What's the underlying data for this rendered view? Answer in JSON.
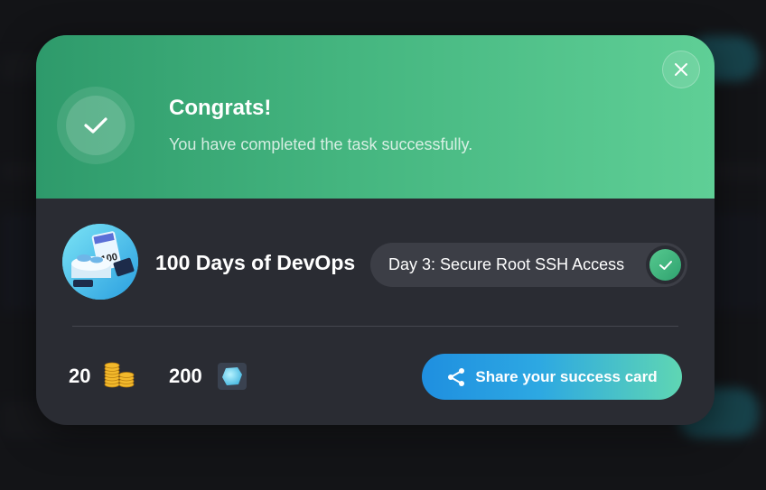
{
  "modal": {
    "title": "Congrats!",
    "subtitle": "You have completed the task successfully.",
    "close_icon": "close-icon",
    "success_icon": "check-icon"
  },
  "course": {
    "name": "100 Days of DevOps",
    "task": "Day 3: Secure Root SSH Access",
    "task_status_icon": "check-icon"
  },
  "rewards": {
    "coins": "20",
    "coins_icon": "coins-icon",
    "gems": "200",
    "gems_icon": "gem-icon"
  },
  "share": {
    "label": "Share your success card",
    "icon": "share-icon"
  },
  "colors": {
    "header_start": "#2e9a6b",
    "header_end": "#5fcf96",
    "card_bg": "#2a2c33",
    "share_start": "#1f8fe0",
    "share_end": "#5fd6b3"
  }
}
